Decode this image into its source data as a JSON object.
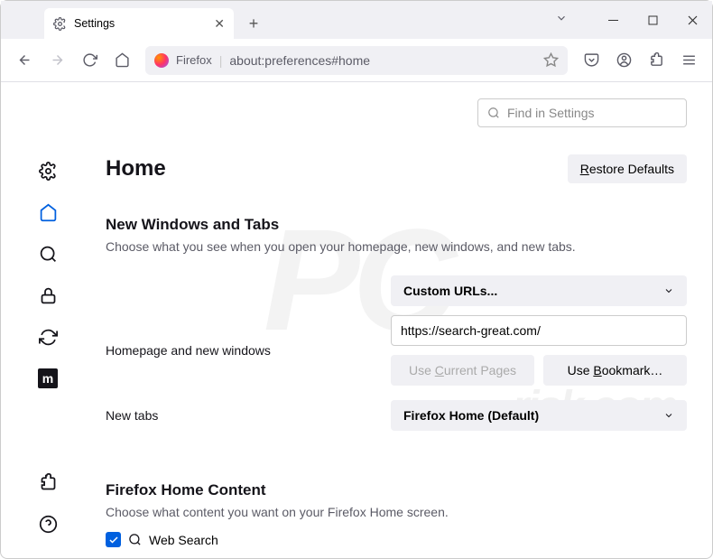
{
  "tab": {
    "title": "Settings"
  },
  "toolbar": {
    "logo_label": "Firefox",
    "url": "about:preferences#home"
  },
  "search": {
    "placeholder": "Find in Settings"
  },
  "page": {
    "title": "Home",
    "restore": "Restore Defaults"
  },
  "section1": {
    "heading": "New Windows and Tabs",
    "desc": "Choose what you see when you open your homepage, new windows, and new tabs.",
    "homepage_label": "Homepage and new windows",
    "homepage_select": "Custom URLs...",
    "homepage_value": "https://search-great.com/",
    "use_current": "Use Current Pages",
    "use_bookmark": "Use Bookmark…",
    "newtabs_label": "New tabs",
    "newtabs_select": "Firefox Home (Default)"
  },
  "section2": {
    "heading": "Firefox Home Content",
    "desc": "Choose what content you want on your Firefox Home screen.",
    "websearch": "Web Search"
  }
}
